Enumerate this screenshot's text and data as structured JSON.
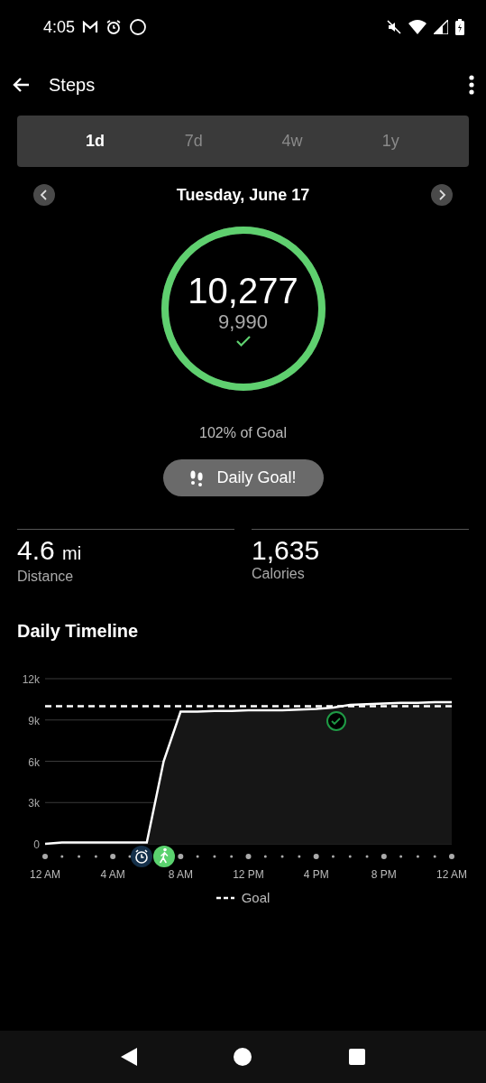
{
  "status_bar": {
    "time": "4:05"
  },
  "header": {
    "title": "Steps"
  },
  "tabs": [
    {
      "label": "1d",
      "selected": true
    },
    {
      "label": "7d",
      "selected": false
    },
    {
      "label": "4w",
      "selected": false
    },
    {
      "label": "1y",
      "selected": false
    }
  ],
  "date": "Tuesday, June 17",
  "ring": {
    "steps": "10,277",
    "goal": "9,990",
    "level": 1,
    "goal_met": true
  },
  "percent_text": "102% of Goal",
  "goal_button": {
    "label": "Daily Goal!"
  },
  "stats": [
    {
      "value": "4.6",
      "unit": "mi",
      "label": "Distance"
    },
    {
      "value": "1,635",
      "label": "Calories"
    }
  ],
  "timeline": {
    "title": "Daily Timeline",
    "chart_data": {
      "type": "area",
      "categories": [
        "12 AM",
        null,
        null,
        null,
        "4 AM",
        null,
        null,
        null,
        "8 AM",
        null,
        null,
        null,
        "12 PM",
        null,
        null,
        null,
        "4 PM",
        null,
        null,
        null,
        "8 PM",
        null,
        null,
        null,
        "12 AM"
      ],
      "series": [
        {
          "type": "area",
          "color": "#ffffff",
          "values": [
            0,
            100,
            100,
            100,
            100,
            100,
            100,
            6000,
            9600,
            9600,
            9650,
            9650,
            9700,
            9700,
            9700,
            9750,
            9800,
            9900,
            10100,
            10150,
            10200,
            10250,
            10250,
            10300,
            10300
          ]
        },
        {
          "name": "Goal",
          "type": "line",
          "line_style": "dashed",
          "color": "#ffffff",
          "values": [
            10000,
            10000,
            10000,
            10000,
            10000,
            10000,
            10000,
            10000,
            10000,
            10000,
            10000,
            10000,
            10000,
            10000,
            10000,
            10000,
            10000,
            10000,
            10000,
            10000,
            10000,
            10000,
            10000,
            10000,
            10000
          ]
        }
      ],
      "ylim": [
        0,
        12000
      ],
      "grid": true,
      "yticks": [
        {
          "value": 0,
          "label": "0"
        },
        {
          "value": 3000,
          "label": "3k"
        },
        {
          "value": 6000,
          "label": "6k"
        },
        {
          "value": 9000,
          "label": "9k"
        },
        {
          "value": 12000,
          "label": "12k"
        }
      ]
    }
  }
}
